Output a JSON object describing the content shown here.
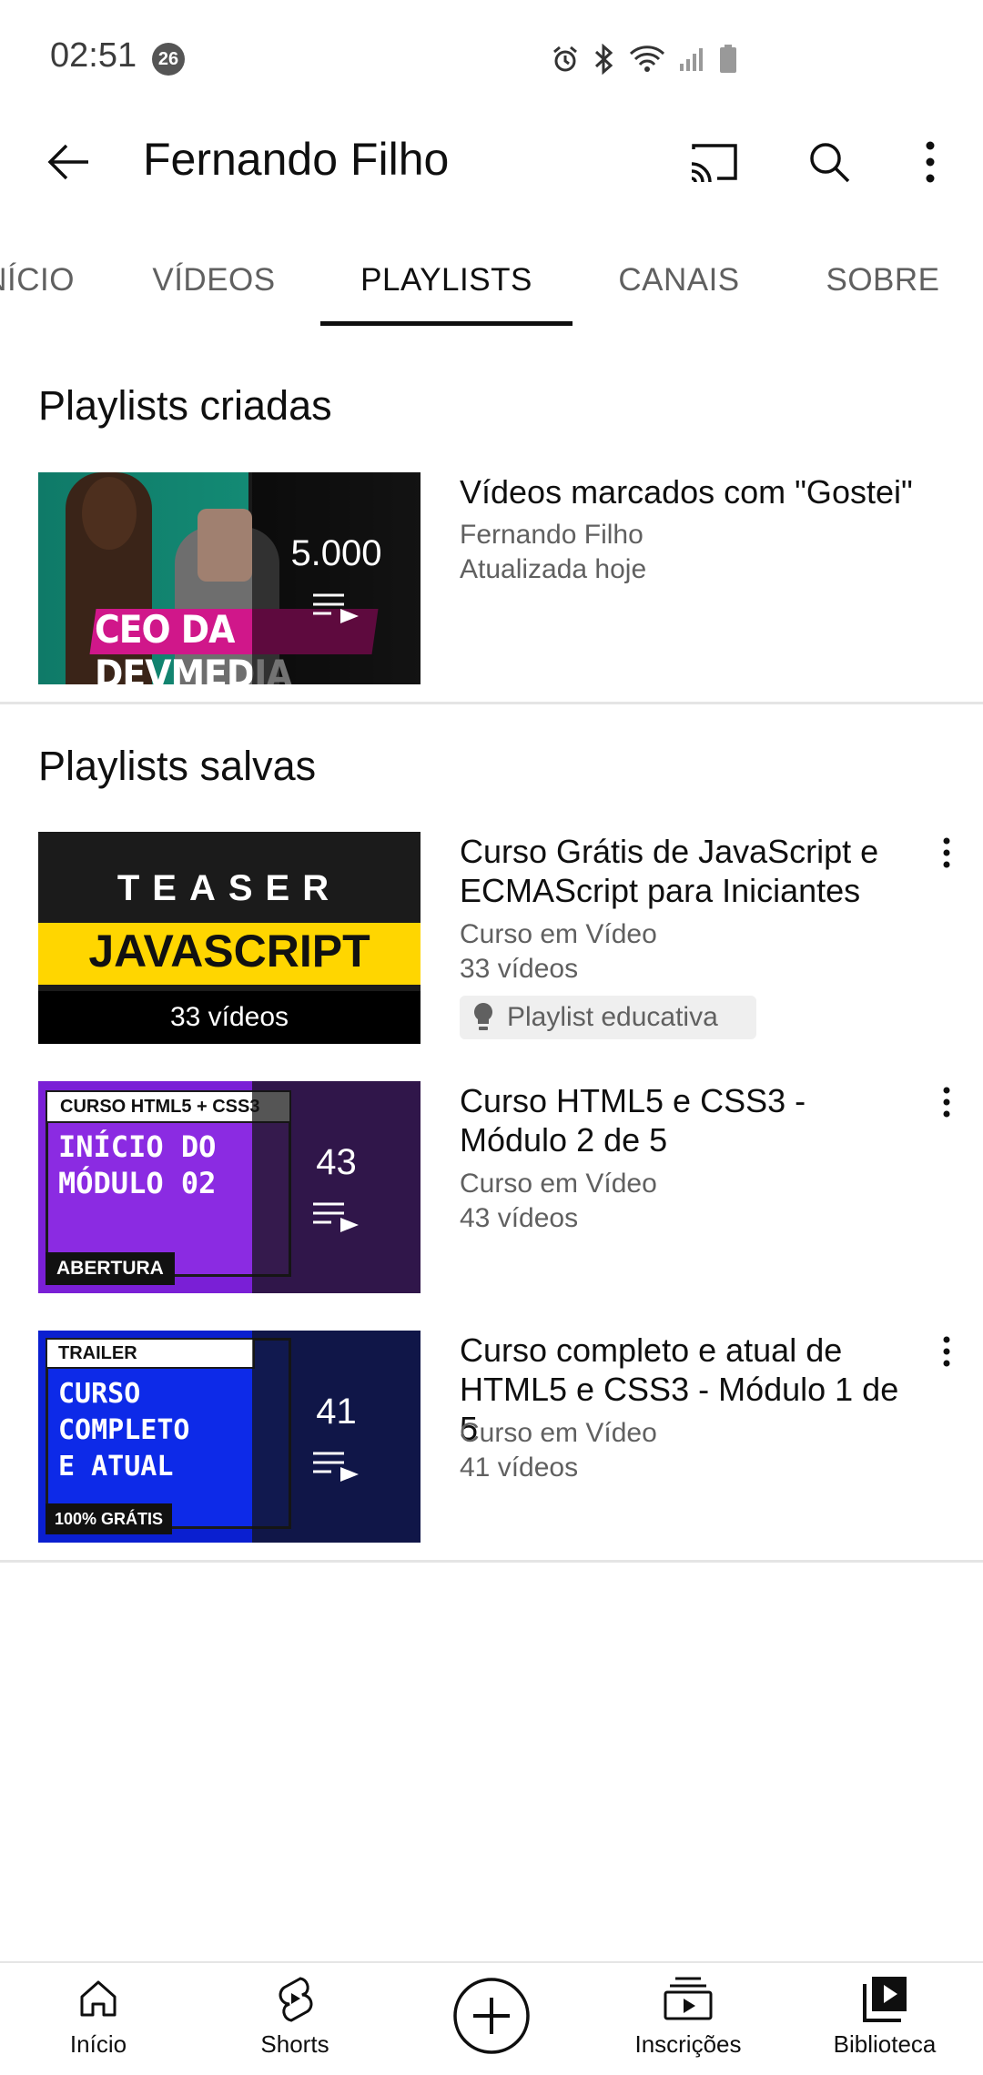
{
  "status_bar": {
    "time": "02:51",
    "notification_count": "26"
  },
  "header": {
    "title": "Fernando Filho"
  },
  "tabs": [
    {
      "label": "INÍCIO"
    },
    {
      "label": "VÍDEOS"
    },
    {
      "label": "PLAYLISTS"
    },
    {
      "label": "CANAIS"
    },
    {
      "label": "SOBRE"
    }
  ],
  "active_tab": "PLAYLISTS",
  "created_section": {
    "title": "Playlists criadas",
    "items": [
      {
        "title": "Vídeos marcados com \"Gostei\"",
        "channel": "Fernando Filho",
        "updated": "Atualizada hoje",
        "count": "5.000",
        "thumb_text": "CEO DA DEVMEDIA"
      }
    ]
  },
  "saved_section": {
    "title": "Playlists salvas",
    "items": [
      {
        "title": "Curso Grátis de JavaScript e ECMAScript para Iniciantes",
        "channel": "Curso em Vídeo",
        "videos": "33 vídeos",
        "badge": "Playlist educativa",
        "thumb_top": "TEASER",
        "thumb_mid": "JAVASCRIPT",
        "thumb_bottom": "33 vídeos"
      },
      {
        "title": "Curso HTML5 e CSS3 - Módulo 2 de 5",
        "channel": "Curso em Vídeo",
        "videos": "43 vídeos",
        "count": "43",
        "thumb_label": "CURSO HTML5 + CSS3",
        "thumb_line1": "INÍCIO DO",
        "thumb_line2": "MÓDULO 02",
        "thumb_tag": "ABERTURA"
      },
      {
        "title": "Curso completo e atual de HTML5 e CSS3 - Módulo 1 de 5",
        "channel": "Curso em Vídeo",
        "videos": "41 vídeos",
        "count": "41",
        "thumb_label": "TRAILER",
        "thumb_line1": "CURSO",
        "thumb_line2": "COMPLETO",
        "thumb_line3": "E ATUAL",
        "thumb_tag": "100% GRÁTIS"
      }
    ]
  },
  "bottom_nav": [
    {
      "label": "Início",
      "icon": "home-icon"
    },
    {
      "label": "Shorts",
      "icon": "shorts-icon"
    },
    {
      "label": "",
      "icon": "create-icon"
    },
    {
      "label": "Inscrições",
      "icon": "subscriptions-icon"
    },
    {
      "label": "Biblioteca",
      "icon": "library-icon"
    }
  ],
  "colors": {
    "text": "#0f0f0f",
    "secondary": "#606060",
    "divider": "#e5e5e5"
  }
}
